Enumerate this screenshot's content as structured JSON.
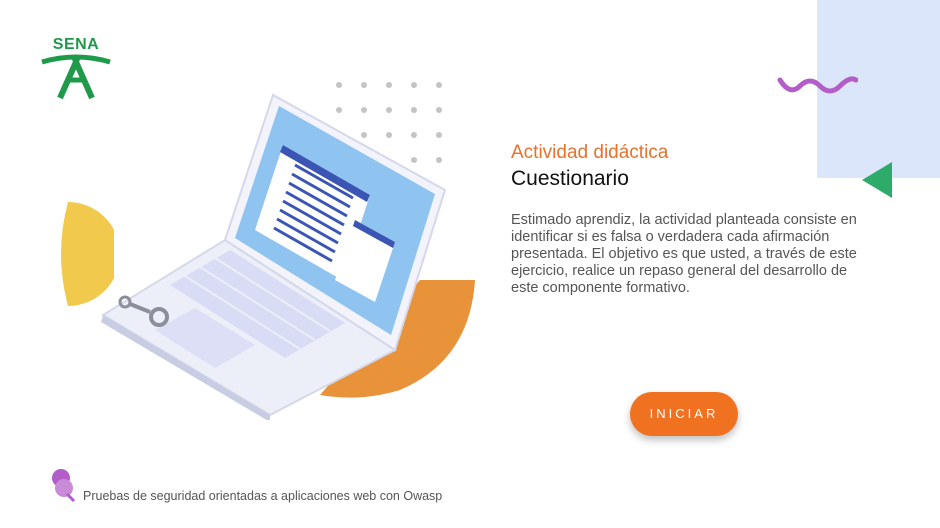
{
  "brand": {
    "logo_text": "SENA",
    "color": "#1e9a4a"
  },
  "activity": {
    "subtitle": "Actividad didáctica",
    "title": "Cuestionario",
    "description": "Estimado aprendiz, la actividad planteada consiste en identificar si es falsa o verdadera cada afirmación presentada. El objetivo es que usted, a través de este ejercicio, realice un repaso general del desarrollo de este componente formativo."
  },
  "actions": {
    "start_label": "INICIAR"
  },
  "footer": {
    "course_name": "Pruebas de seguridad orientadas a aplicaciones web con Owasp",
    "icon": "pin-icon"
  },
  "colors": {
    "accent": "#f07221",
    "subtitle": "#e8722a",
    "panel": "#dce6fb",
    "wave": "#b35ec8",
    "triangle": "#2eaa6a",
    "yellow": "#f0c94d"
  }
}
